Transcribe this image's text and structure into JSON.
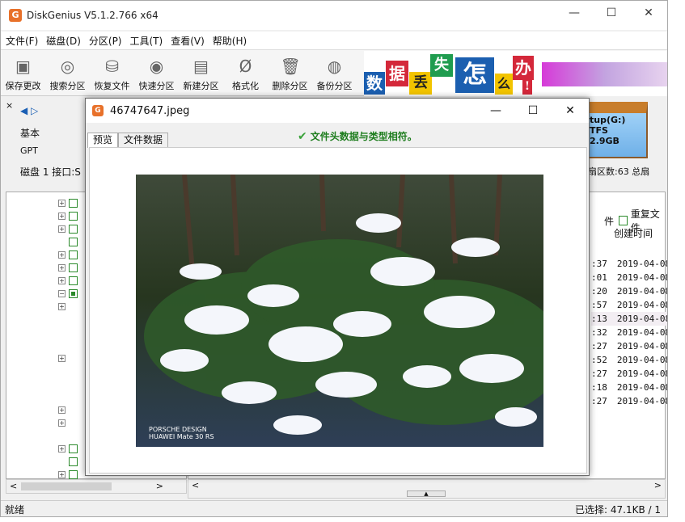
{
  "window": {
    "title": "DiskGenius V5.1.2.766 x64",
    "icon_letter": "G",
    "minimize": "—",
    "maximize": "☐",
    "close": "✕"
  },
  "menu": [
    "文件(F)",
    "磁盘(D)",
    "分区(P)",
    "工具(T)",
    "查看(V)",
    "帮助(H)"
  ],
  "toolbar": [
    {
      "label": "保存更改",
      "icon": "save-icon"
    },
    {
      "label": "搜索分区",
      "icon": "search-icon"
    },
    {
      "label": "恢复文件",
      "icon": "recover-icon"
    },
    {
      "label": "快速分区",
      "icon": "quick-partition-icon"
    },
    {
      "label": "新建分区",
      "icon": "new-partition-icon"
    },
    {
      "label": "格式化",
      "icon": "format-icon"
    },
    {
      "label": "删除分区",
      "icon": "delete-partition-icon"
    },
    {
      "label": "备份分区",
      "icon": "backup-partition-icon"
    }
  ],
  "banner": {
    "chars": [
      "数",
      "据",
      "丢",
      "失",
      "怎",
      "么",
      "办",
      "!"
    ]
  },
  "disk": {
    "type": "基本",
    "scheme": "GPT",
    "info": "磁盘 1 接口:S",
    "partition_label": "tup(G:)",
    "partition_fs": "TFS",
    "partition_size": "2.9GB",
    "sectors": "扇区数:63  总扇"
  },
  "right_panel": {
    "duplicate_files": "重复文件",
    "col_created": "创建时间",
    "times": [
      ":37",
      ":01",
      ":20",
      ":57",
      ":13",
      ":32",
      ":27",
      ":52",
      ":27",
      ":18",
      ":27"
    ],
    "dates": [
      "2019-04-08",
      "2019-04-08",
      "2019-04-08",
      "2019-04-08",
      "2019-04-08",
      "2019-04-08",
      "2019-04-08",
      "2019-04-08",
      "2019-04-08",
      "2019-04-08",
      "2019-04-08"
    ]
  },
  "dialog": {
    "title": "46747647.jpeg",
    "tabs": [
      "预览",
      "文件数据"
    ],
    "active_tab": "预览",
    "match_text": "文件头数据与类型相符。",
    "watermark_line1": "PORSCHE DESIGN",
    "watermark_line2": "HUAWEI Mate 30 RS"
  },
  "status": {
    "left": "就绪",
    "right": "已选择: 47.1KB / 1"
  }
}
